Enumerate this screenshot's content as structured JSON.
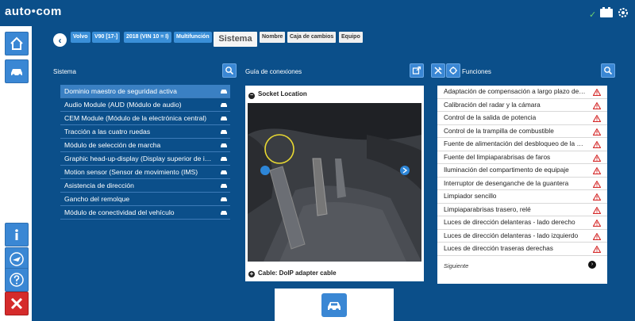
{
  "app": {
    "logo_main": "auto",
    "logo_mark": "•",
    "logo_tail": "com"
  },
  "topbar": {
    "check_icon": "check-icon",
    "battery_icon": "battery-icon",
    "gear_icon": "settings-gear-icon",
    "check_glyph": "✓"
  },
  "rail": {
    "buttons": [
      {
        "name": "home-icon"
      },
      {
        "name": "vehicle-diagnostic-icon"
      },
      {
        "name": "info-icon"
      },
      {
        "name": "airplane-icon"
      },
      {
        "name": "help-icon"
      },
      {
        "name": "close-icon"
      }
    ]
  },
  "breadcrumb": {
    "back_glyph": "‹",
    "items": [
      "Volvo",
      "V90 [17-]",
      "2018 (VIN 10 = I)",
      "Multifunción"
    ],
    "active": "Sistema",
    "pending": [
      "Nombre",
      "Caja de cambios",
      "Equipo"
    ]
  },
  "sistema": {
    "title": "Sistema",
    "items": [
      "Dominio maestro de seguridad activa",
      "Audio Module (AUD (Módulo de audio)",
      "CEM Module (Módulo de la electrónica central)",
      "Tracción a las cuatro ruedas",
      "Módulo de selección de marcha",
      "Graphic head-up-display (Display superior de información)",
      "Motion sensor (Sensor de movimiento (IMS)",
      "Asistencia de dirección",
      "Gancho del remolque",
      "Módulo de conectividad del vehículo"
    ],
    "active_index": 0
  },
  "guia": {
    "title": "Guía de conexiones",
    "socket_label": "Socket Location",
    "cable_label": "Cable: DoIP adapter cable",
    "minus_glyph": "−",
    "plus_glyph": "+"
  },
  "funciones": {
    "title": "Funciones",
    "items": [
      "Adaptación de compensación a largo plazo de la dirección",
      "Calibración del radar y la cámara",
      "Control de la salida de potencia",
      "Control de la trampilla de combustible",
      "Fuente de alimentación del desbloqueo de la puerta",
      "Fuente del limpiaparabrisas de faros",
      "Iluminación del compartimento de equipaje",
      "Interruptor de desenganche de la guantera",
      "Limpiador sencillo",
      "Limpiaparabrisas trasero, relé",
      "Luces de dirección delanteras - lado derecho",
      "Luces de dirección delanteras - lado izquierdo",
      "Luces de dirección traseras derechas"
    ],
    "next_label": "Siguiente",
    "next_glyph": "›"
  },
  "colors": {
    "background": "#0b4f8a",
    "accent": "#3a87d4",
    "warning": "#d52b2b"
  }
}
